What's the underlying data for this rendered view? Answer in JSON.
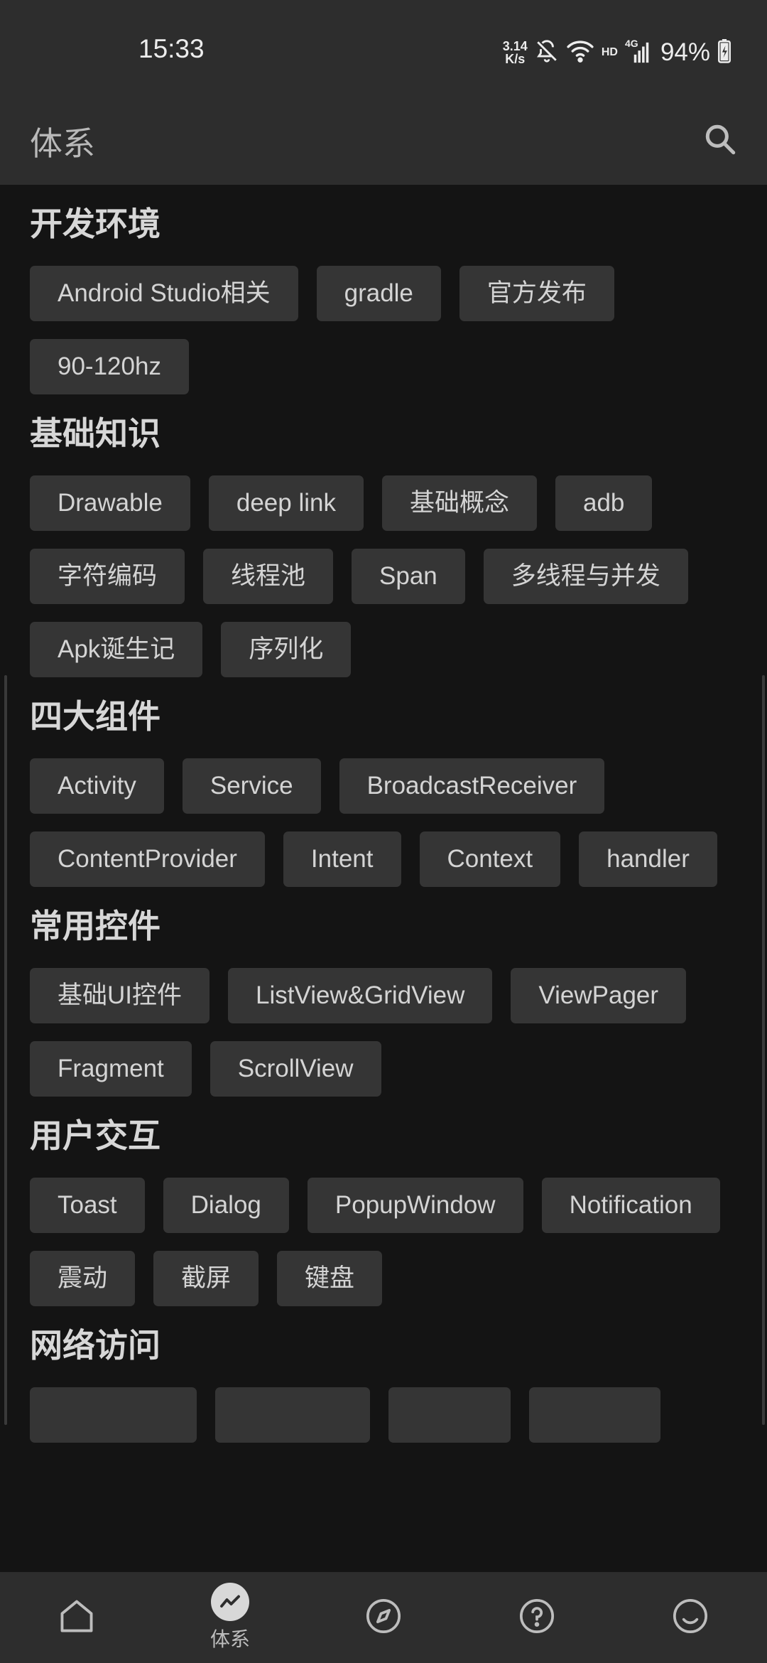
{
  "status": {
    "time": "15:33",
    "net_speed_value": "3.14",
    "net_speed_unit": "K/s",
    "network_label": "HD",
    "network_type": "4G",
    "battery": "94%"
  },
  "toolbar": {
    "title": "体系"
  },
  "categories": [
    {
      "title": "开发环境",
      "chips": [
        "Android Studio相关",
        "gradle",
        "官方发布",
        "90-120hz"
      ]
    },
    {
      "title": "基础知识",
      "chips": [
        "Drawable",
        "deep link",
        "基础概念",
        "adb",
        "字符编码",
        "线程池",
        "Span",
        "多线程与并发",
        "Apk诞生记",
        "序列化"
      ]
    },
    {
      "title": "四大组件",
      "chips": [
        "Activity",
        "Service",
        "BroadcastReceiver",
        "ContentProvider",
        "Intent",
        "Context",
        "handler"
      ]
    },
    {
      "title": "常用控件",
      "chips": [
        "基础UI控件",
        "ListView&GridView",
        "ViewPager",
        "Fragment",
        "ScrollView"
      ]
    },
    {
      "title": "用户交互",
      "chips": [
        "Toast",
        "Dialog",
        "PopupWindow",
        "Notification",
        "震动",
        "截屏",
        "键盘"
      ]
    },
    {
      "title": "网络访问",
      "chips": [
        "",
        "",
        "",
        ""
      ]
    }
  ],
  "bottom_nav": [
    {
      "icon": "home-icon",
      "label": ""
    },
    {
      "icon": "trending-icon",
      "label": "体系",
      "active": true
    },
    {
      "icon": "compass-icon",
      "label": ""
    },
    {
      "icon": "question-icon",
      "label": ""
    },
    {
      "icon": "smile-icon",
      "label": ""
    }
  ]
}
